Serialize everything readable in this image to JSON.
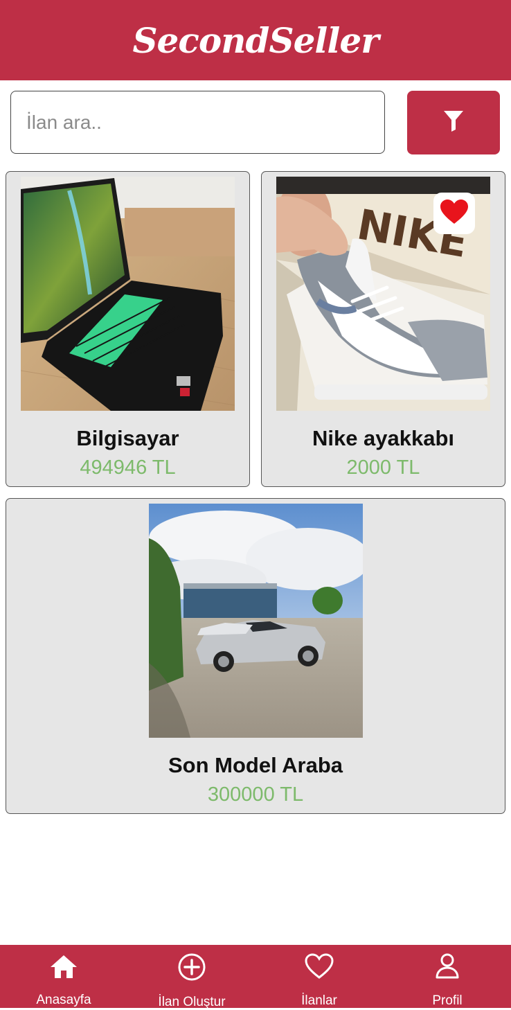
{
  "header": {
    "app_name": "SecondSeller"
  },
  "search": {
    "placeholder": "İlan ara..",
    "value": ""
  },
  "listings": [
    {
      "title": "Bilgisayar",
      "price": "494946 TL",
      "favorited": false
    },
    {
      "title": "Nike ayakkabı",
      "price": "2000 TL",
      "favorited": true
    },
    {
      "title": "Son Model Araba",
      "price": "300000 TL",
      "favorited": false
    }
  ],
  "icons": {
    "filter": "filter-icon",
    "favorite": "heart-filled-icon",
    "home": "home-icon",
    "create": "plus-circle-icon",
    "listings": "heart-outline-icon",
    "profile": "user-icon"
  },
  "colors": {
    "brand": "#be2f46",
    "price": "#7dba6b",
    "card_bg": "#e6e6e6",
    "favorite": "#e8141c"
  },
  "bottom_nav": [
    {
      "label": "Anasayfa"
    },
    {
      "label": "İlan Oluştur"
    },
    {
      "label": "İlanlar"
    },
    {
      "label": "Profil"
    }
  ]
}
